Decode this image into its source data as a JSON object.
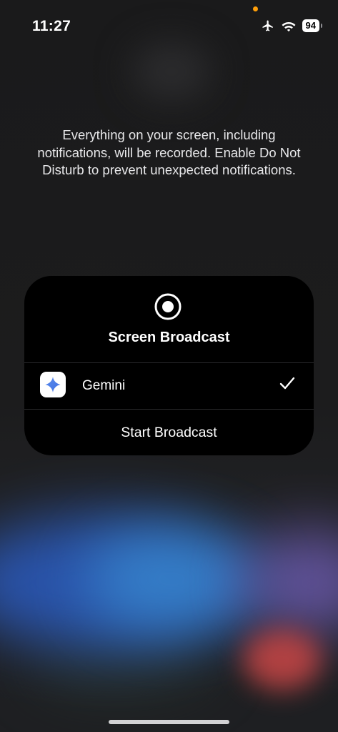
{
  "status_bar": {
    "time": "11:27",
    "battery": "94",
    "icons": [
      "airplane-icon",
      "wifi-icon",
      "battery-icon"
    ],
    "privacy_indicator_color": "#ff9f0a"
  },
  "notice_text": "Everything on your screen, including notifications, will be recorded. Enable Do Not Disturb to prevent unexpected notifications.",
  "broadcast_sheet": {
    "icon": "record-icon",
    "title": "Screen Broadcast",
    "selected_app": {
      "label": "Gemini",
      "icon": "gemini-sparkle-icon",
      "selected": true
    },
    "start_button_label": "Start Broadcast"
  },
  "colors": {
    "sheet_background": "#000000",
    "gemini_blue": "#4a86f5"
  }
}
